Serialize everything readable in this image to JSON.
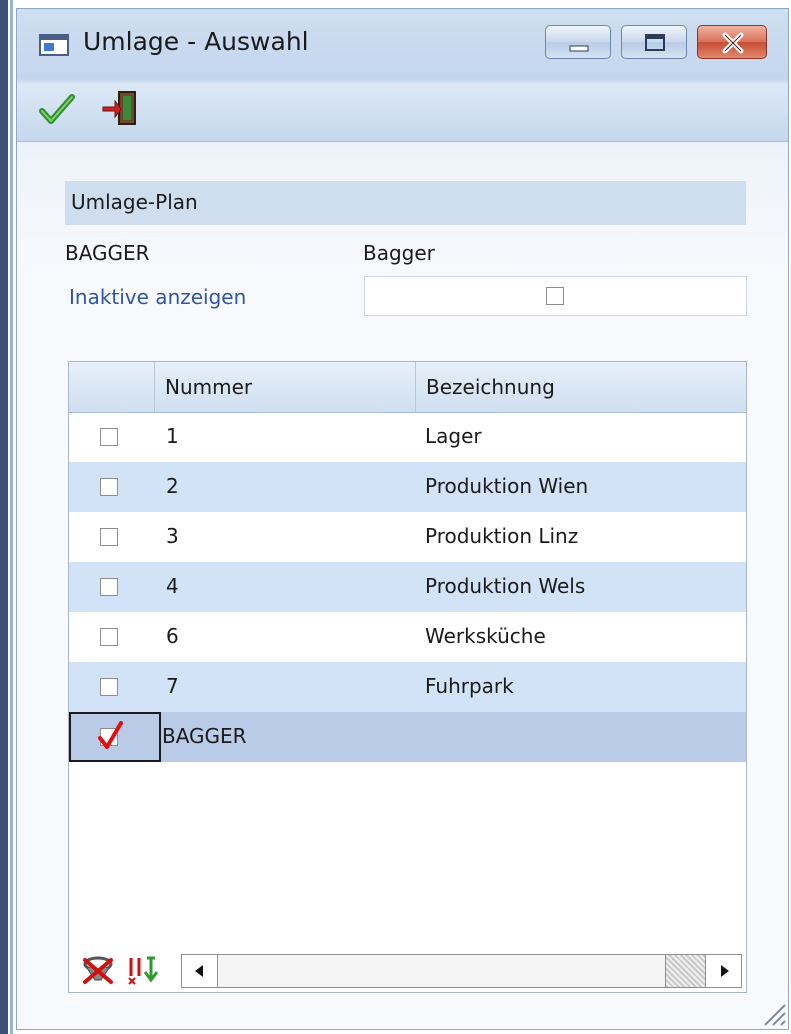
{
  "window": {
    "title": "Umlage - Auswahl",
    "controls": {
      "minimize": "minimize",
      "maximize": "maximize",
      "close": "close"
    }
  },
  "toolbar": {
    "ok_icon": "checkmark-icon",
    "exit_icon": "exit-door-icon"
  },
  "form": {
    "section_title": "Umlage-Plan",
    "plan_code": "BAGGER",
    "plan_name": "Bagger",
    "inactive_label": "Inaktive anzeigen",
    "inactive_checked": false
  },
  "grid": {
    "columns": [
      "",
      "Nummer",
      "Bezeichnung"
    ],
    "rows": [
      {
        "checked": false,
        "nummer": "1",
        "bezeichnung": "Lager"
      },
      {
        "checked": false,
        "nummer": "2",
        "bezeichnung": "Produktion Wien"
      },
      {
        "checked": false,
        "nummer": "3",
        "bezeichnung": "Produktion Linz"
      },
      {
        "checked": false,
        "nummer": "4",
        "bezeichnung": "Produktion Wels"
      },
      {
        "checked": false,
        "nummer": "6",
        "bezeichnung": "Werksküche"
      },
      {
        "checked": false,
        "nummer": "7",
        "bezeichnung": "Fuhrpark"
      },
      {
        "checked": true,
        "nummer": "BAGGER",
        "bezeichnung": ""
      }
    ],
    "footer_icons": [
      "clear-filter-icon",
      "sort-icon"
    ]
  },
  "colors": {
    "row_alt": "#d2e3f7",
    "row_selected": "#b9cbe6",
    "link_blue": "#3155a5",
    "check_red": "#e01010",
    "ok_green": "#2f8f2f"
  }
}
